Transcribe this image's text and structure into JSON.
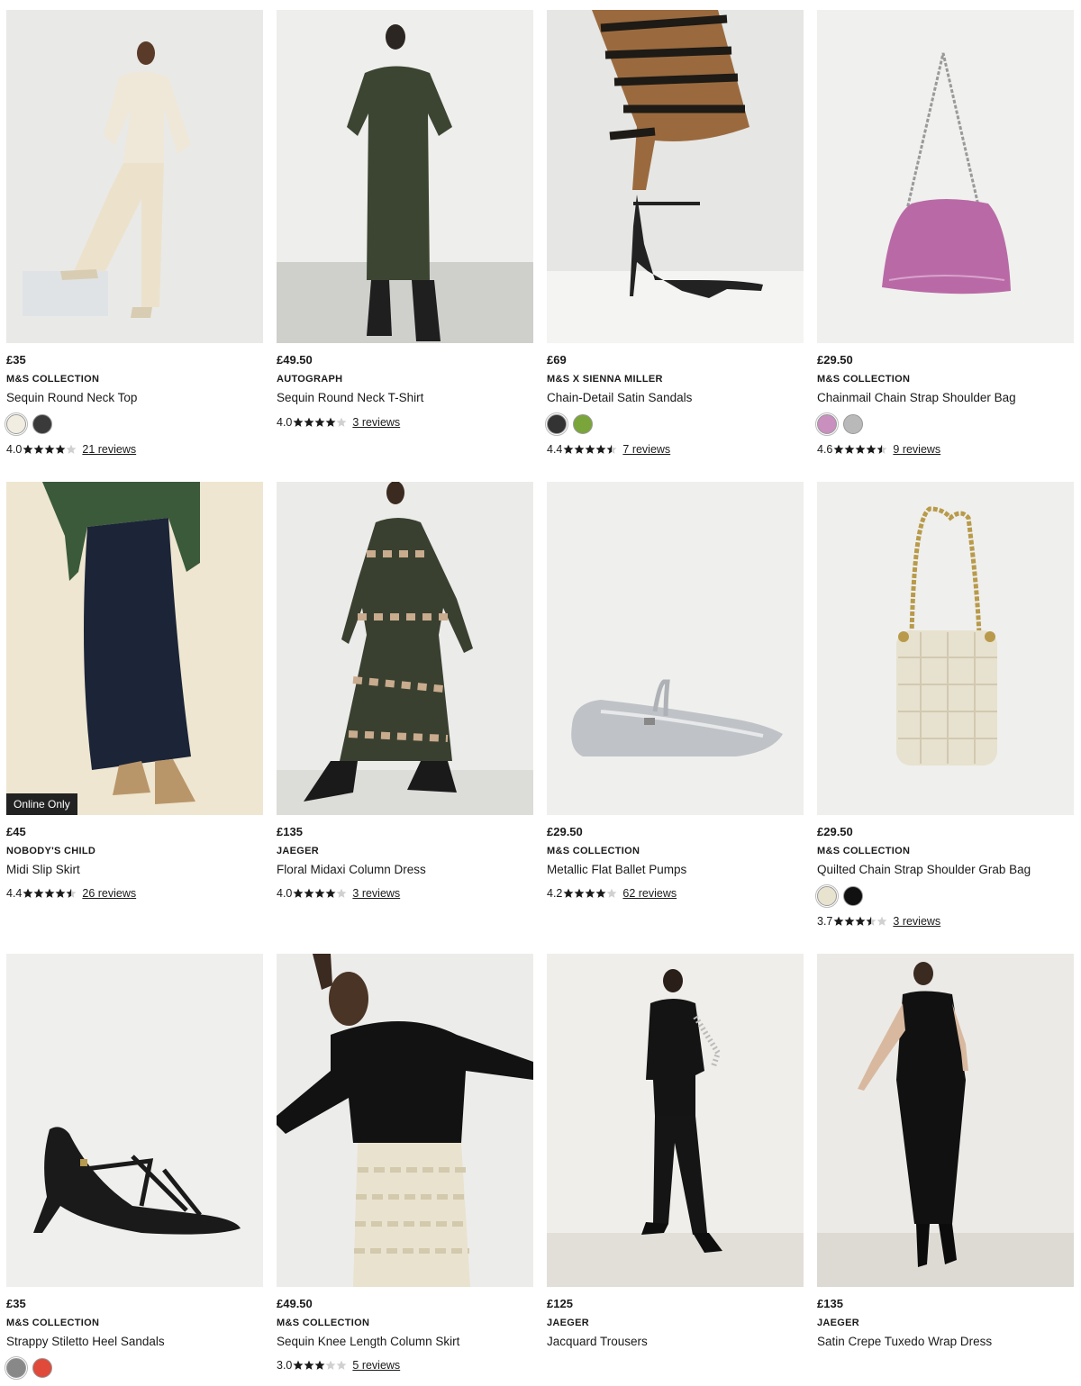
{
  "products": [
    {
      "price": "£35",
      "brand": "M&S COLLECTION",
      "name": "Sequin Round Neck Top",
      "swatches": [
        "#f1ede0",
        "#3a3a3a"
      ],
      "rating": "4.0",
      "stars": 4.0,
      "reviews": "21 reviews",
      "badge": ""
    },
    {
      "price": "£49.50",
      "brand": "AUTOGRAPH",
      "name": "Sequin Round Neck T-Shirt",
      "swatches": [],
      "rating": "4.0",
      "stars": 4.0,
      "reviews": "3 reviews",
      "badge": ""
    },
    {
      "price": "£69",
      "brand": "M&S X SIENNA MILLER",
      "name": "Chain-Detail Satin Sandals",
      "swatches": [
        "#333333",
        "#7aa53a"
      ],
      "rating": "4.4",
      "stars": 4.5,
      "reviews": "7 reviews",
      "badge": ""
    },
    {
      "price": "£29.50",
      "brand": "M&S COLLECTION",
      "name": "Chainmail Chain Strap Shoulder Bag",
      "swatches": [
        "#c98fbf",
        "#b9b9b9"
      ],
      "rating": "4.6",
      "stars": 4.5,
      "reviews": "9 reviews",
      "badge": ""
    },
    {
      "price": "£45",
      "brand": "NOBODY'S CHILD",
      "name": "Midi Slip Skirt",
      "swatches": [],
      "rating": "4.4",
      "stars": 4.5,
      "reviews": "26 reviews",
      "badge": "Online Only"
    },
    {
      "price": "£135",
      "brand": "JAEGER",
      "name": "Floral Midaxi Column Dress",
      "swatches": [],
      "rating": "4.0",
      "stars": 4.0,
      "reviews": "3 reviews",
      "badge": ""
    },
    {
      "price": "£29.50",
      "brand": "M&S COLLECTION",
      "name": "Metallic Flat Ballet Pumps",
      "swatches": [],
      "rating": "4.2",
      "stars": 4.0,
      "reviews": "62 reviews",
      "badge": ""
    },
    {
      "price": "£29.50",
      "brand": "M&S COLLECTION",
      "name": "Quilted Chain Strap Shoulder Grab Bag",
      "swatches": [
        "#e8e3cf",
        "#111111"
      ],
      "rating": "3.7",
      "stars": 3.5,
      "reviews": "3 reviews",
      "badge": ""
    },
    {
      "price": "£35",
      "brand": "M&S COLLECTION",
      "name": "Strappy Stiletto Heel Sandals",
      "swatches": [
        "#888888",
        "#e04a3a"
      ],
      "rating": "",
      "stars": 0,
      "reviews": "",
      "badge": ""
    },
    {
      "price": "£49.50",
      "brand": "M&S COLLECTION",
      "name": "Sequin Knee Length Column Skirt",
      "swatches": [],
      "rating": "3.0",
      "stars": 3.0,
      "reviews": "5 reviews",
      "badge": ""
    },
    {
      "price": "£125",
      "brand": "JAEGER",
      "name": "Jacquard Trousers",
      "swatches": [],
      "rating": "",
      "stars": 0,
      "reviews": "",
      "badge": ""
    },
    {
      "price": "£135",
      "brand": "JAEGER",
      "name": "Satin Crepe Tuxedo Wrap Dress",
      "swatches": [],
      "rating": "",
      "stars": 0,
      "reviews": "",
      "badge": ""
    }
  ],
  "colors": {
    "star_filled": "#1a1a1a",
    "star_empty": "#d0d0d0"
  }
}
